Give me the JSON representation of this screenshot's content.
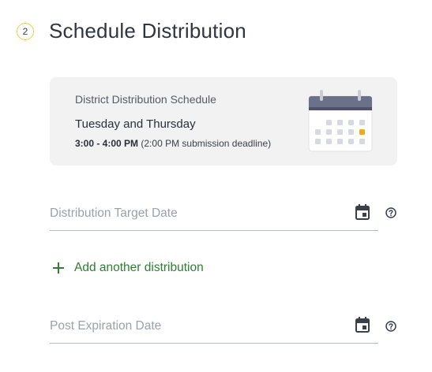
{
  "section": {
    "step_number": "2",
    "title": "Schedule Distribution"
  },
  "schedule_card": {
    "heading": "District Distribution Schedule",
    "days": "Tuesday and Thursday",
    "time": "3:00 - 4:00 PM",
    "note": "(2:00 PM submission deadline)",
    "icon": "calendar-illustration",
    "highlight_color": "#f0a820"
  },
  "fields": {
    "target_date_label": "Distribution Target Date",
    "expiration_date_label": "Post Expiration Date"
  },
  "actions": {
    "add_distribution_label": "Add another distribution"
  },
  "colors": {
    "accent_green": "#2e7d32",
    "step_ring": "#f2c94c",
    "card_bg": "#f2f2f3"
  }
}
